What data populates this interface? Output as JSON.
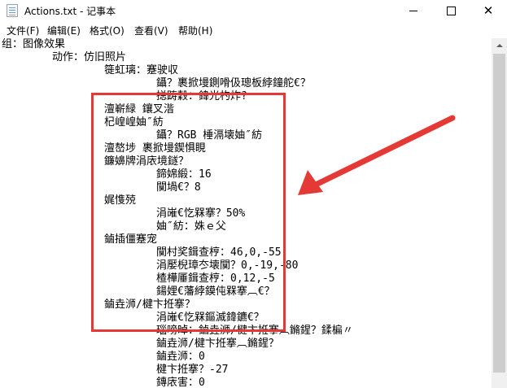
{
  "window": {
    "title": "Actions.txt - 记事本",
    "minimize_glyph": "",
    "close_glyph": "✕"
  },
  "menu": {
    "items": [
      "文件(F)",
      "编辑(E)",
      "格式(O)",
      "查看(V)",
      "帮助(H)"
    ]
  },
  "document": {
    "lines": [
      "组：图像效果",
      "动作：仿旧照片",
      "簁虹璃：蹇驶収",
      "鑷？裹掀墁鍘嗗伋璁板綍鐘舵€？",
      "搃踌穀：鍏光杓炸?",
      "澶嶄緑 鑲叉湝",
      "杞崲崲妯″紡",
      "鑷？RGB 棰滆壊妯″紡",
      "澶嶅埗 裹掀墁鍥惧睍",
      "鐮嬶牌涓庡境鐩？",
      "鍗婂緞：16",
      "闃堝€？8",
      "娓愯殑",
      "涓嶉€忔槑搴？50%",
      "妯″紡：姝ｅ父",
      "鏀插僵蹇宠",
      "闃村奖鍓查梈：46,0,-55",
      "涓嬮棿璋冭壊闃？0,-19,-80",
      "楂樺厜鍓查梈：0,12,-5",
      "鍚娌€藩綍鏌伅槑搴︹€？",
      "鏀垚浉/楗卞拰搴？",
      "涓嶉€忔槑鏂滅鍏鑣€？",
      "瑙嗙晫：鏀垚浉/楗卞拰搴︹鏅鍟？鍒楄〃",
      "鏀垚浉/楗卞拰搴︹鏅鍟？",
      "鏀垚浉：0",
      "楗卞拰搴？-27",
      "鏄庡害：0"
    ]
  },
  "annotation": {
    "box_color": "#e53935",
    "arrow_color": "#e53935"
  }
}
